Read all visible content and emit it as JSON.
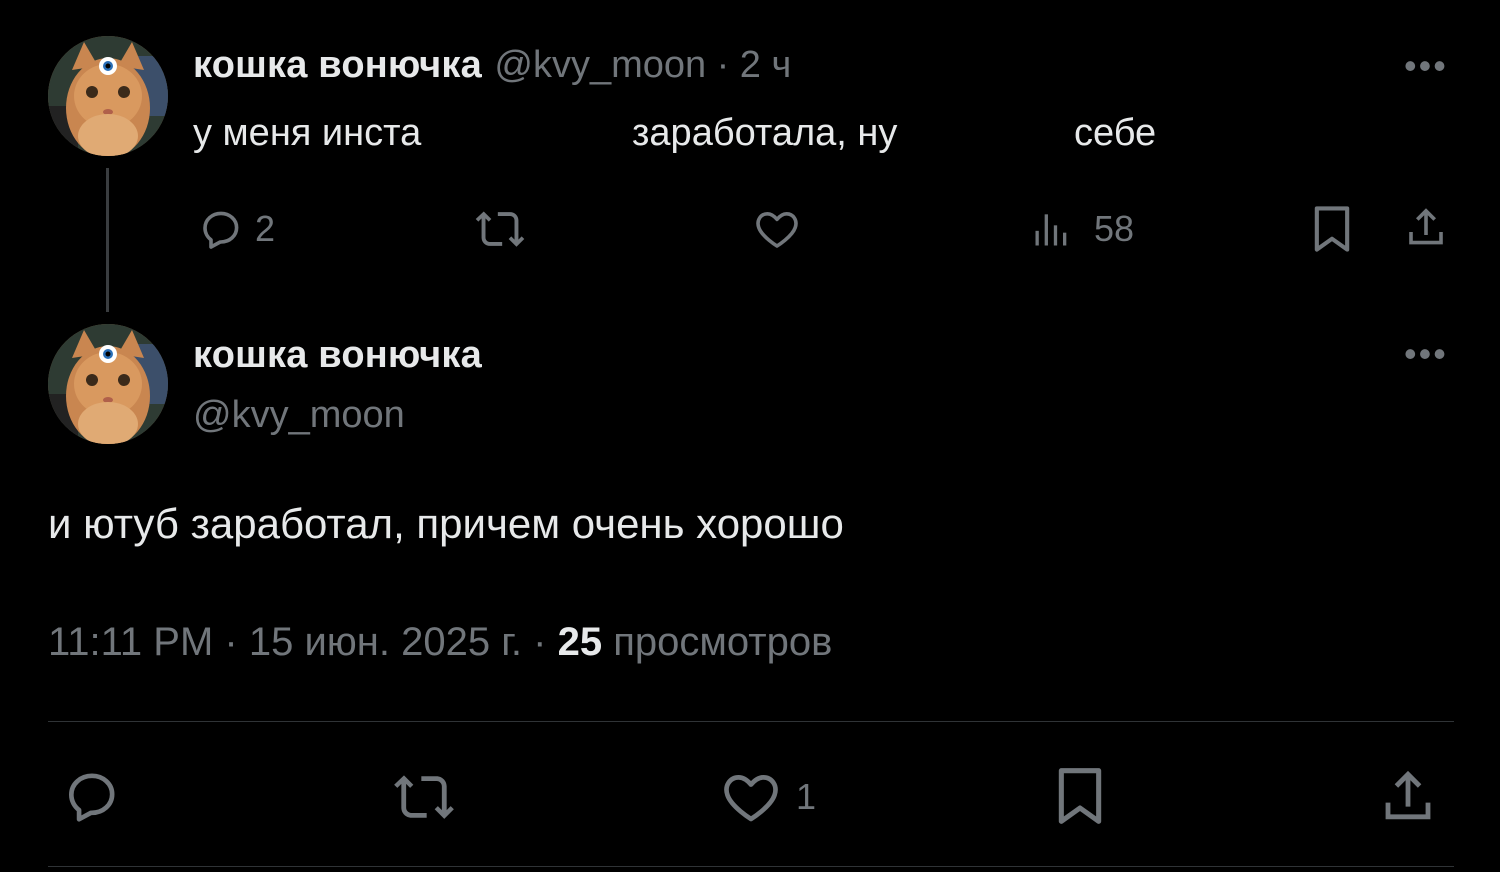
{
  "parent_tweet": {
    "display_name": "кошка вонючка",
    "handle": "@kvy_moon",
    "separator": "·",
    "time_ago": "2 ч",
    "text_part1": "у меня инста",
    "text_part2": "заработала, ну",
    "text_part3": "себе",
    "actions": {
      "reply_count": "2",
      "retweet_count": "",
      "like_count": "",
      "views_count": "58"
    },
    "icons": [
      "reply-icon",
      "retweet-icon",
      "like-icon",
      "views-icon",
      "bookmark-icon",
      "share-icon",
      "more-icon"
    ]
  },
  "main_tweet": {
    "display_name": "кошка вонючка",
    "handle": "@kvy_moon",
    "text": "и ютуб заработал, причем очень хорошо",
    "time": "11:11 PM",
    "separator": "·",
    "date": "15 июн. 2025 г.",
    "views_count": "25",
    "views_label": "просмотров",
    "actions": {
      "reply_count": "",
      "retweet_count": "",
      "like_count": "1"
    },
    "icons": [
      "reply-icon",
      "retweet-icon",
      "like-icon",
      "bookmark-icon",
      "share-icon",
      "more-icon"
    ]
  },
  "colors": {
    "background": "#000000",
    "text_primary": "#e7e9ea",
    "text_secondary": "#71767b",
    "divider": "#2f3336"
  }
}
